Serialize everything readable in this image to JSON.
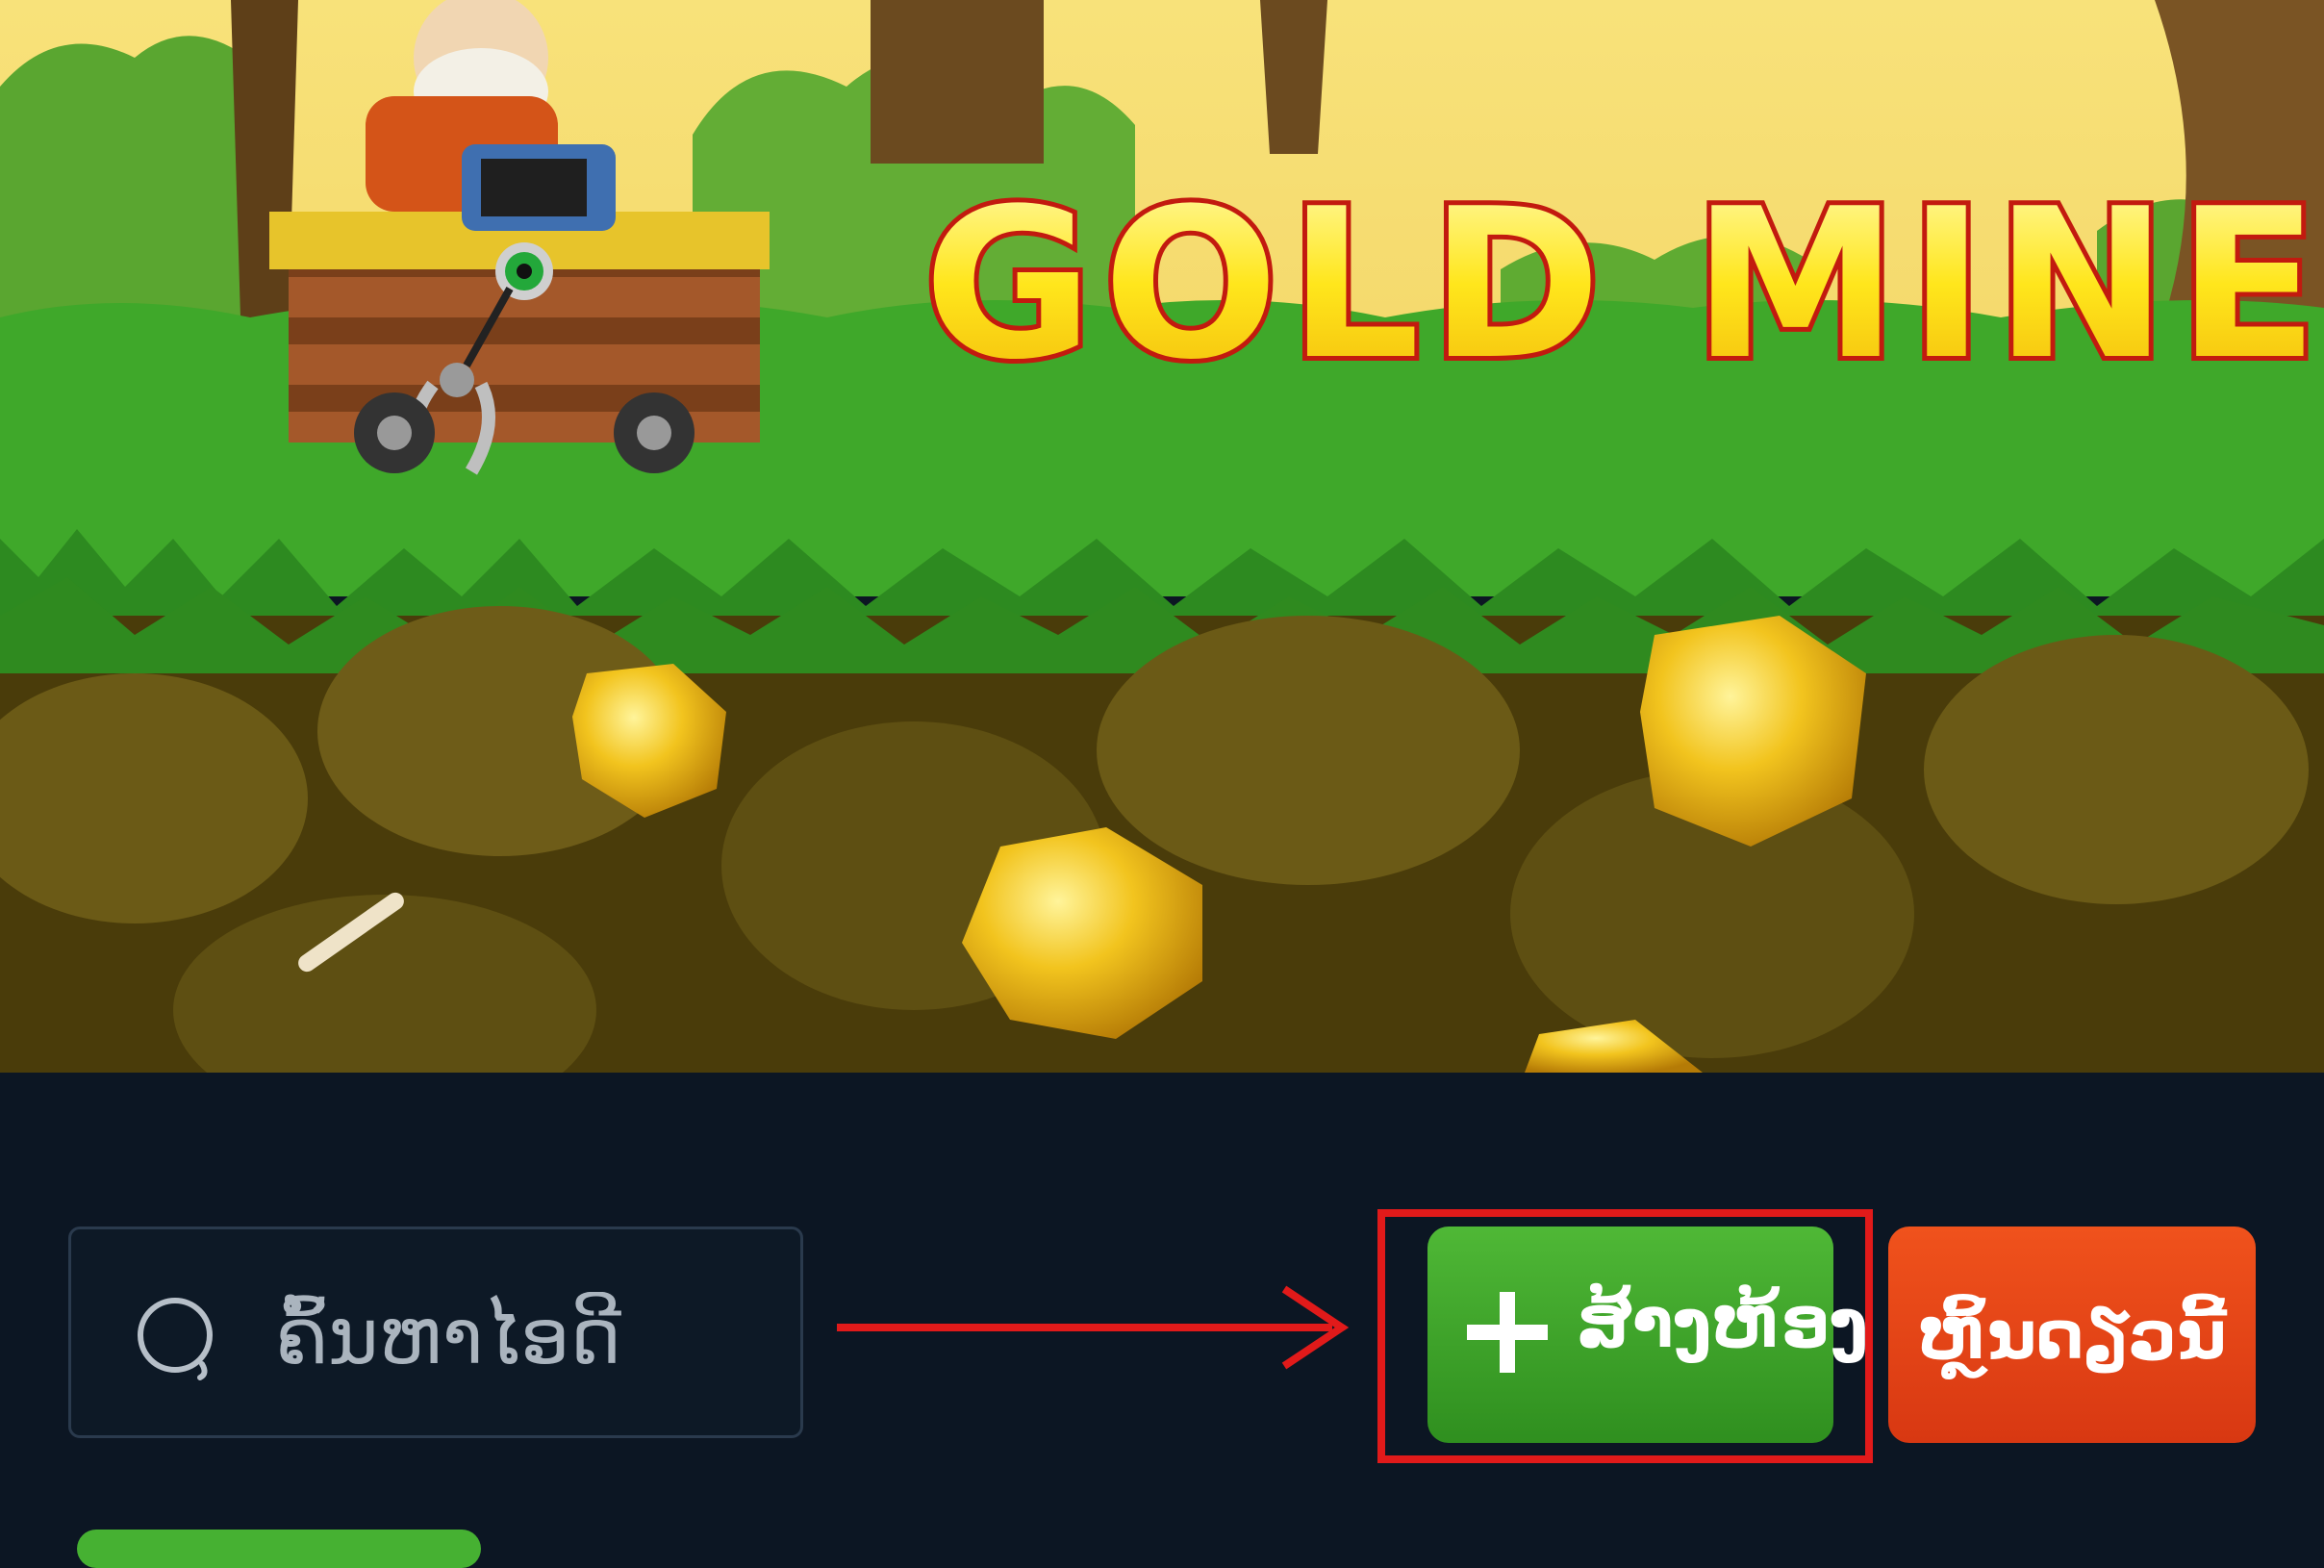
{
  "game": {
    "title": "GOLD MINER"
  },
  "search": {
    "placeholder": "ຄົ້ນຫາໄອດີ",
    "icon": "search-icon"
  },
  "actions": {
    "create_room_label": "ສ້າງຫ້ອງ",
    "create_room_icon": "plus-icon",
    "join_now_label": "ຫຼິ້ນດຽວນີ້"
  },
  "colors": {
    "panel_bg": "#0c1623",
    "create_button": "#3aa327",
    "join_button": "#e8461a",
    "highlight": "#e11a1a"
  }
}
